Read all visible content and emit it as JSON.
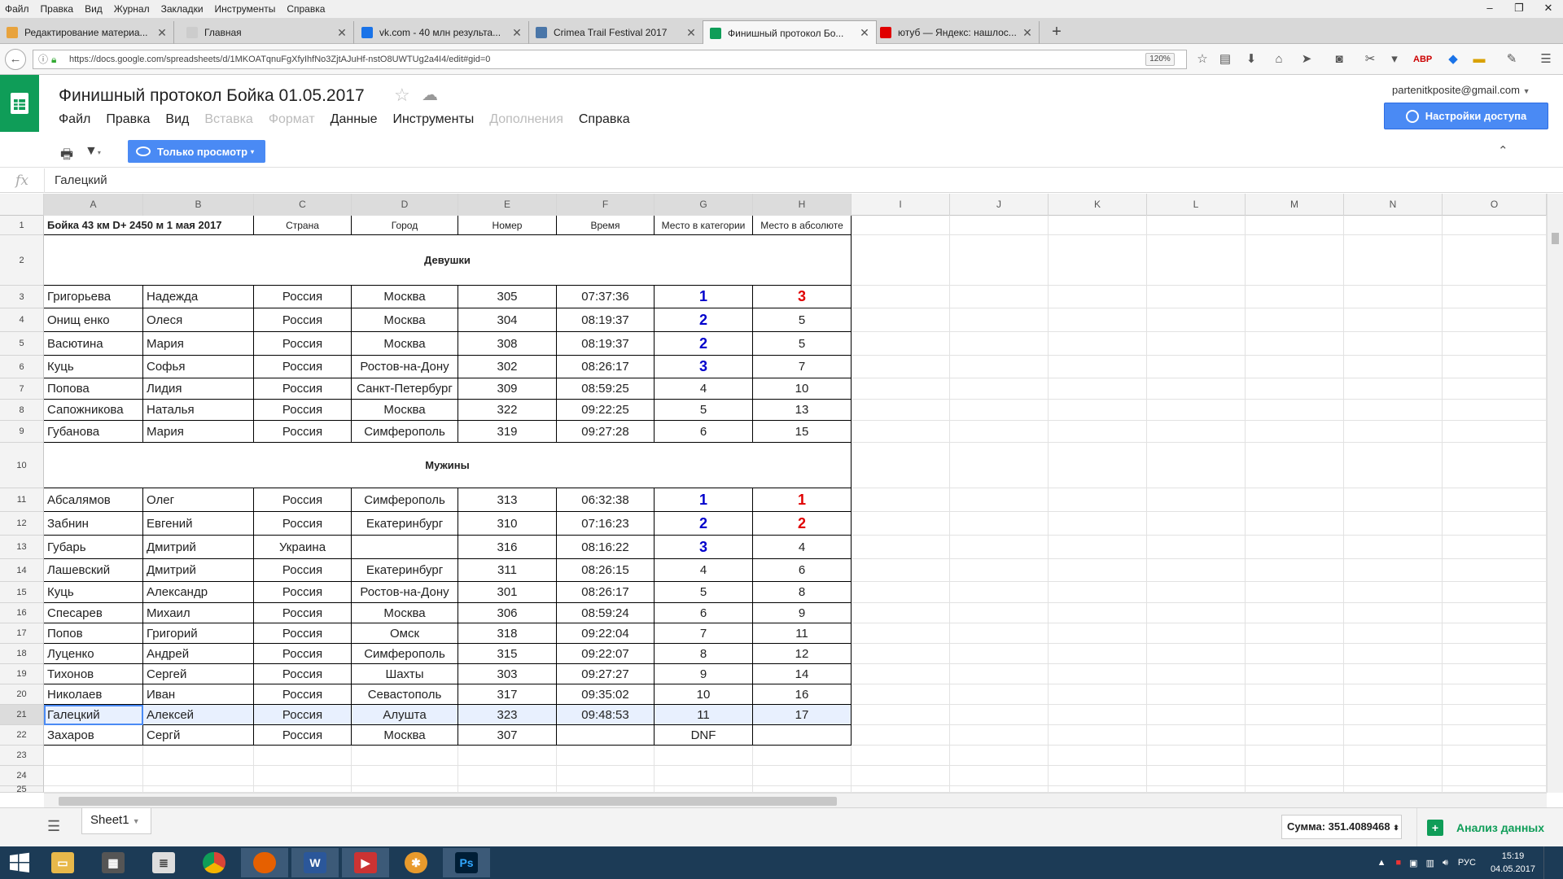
{
  "browser": {
    "menu": [
      "Файл",
      "Правка",
      "Вид",
      "Журнал",
      "Закладки",
      "Инструменты",
      "Справка"
    ],
    "tabs": [
      {
        "label": "Редактирование материа...",
        "color": "#e8a33d"
      },
      {
        "label": "Главная",
        "color": "#cccccc"
      },
      {
        "label": "vk.com - 40 млн результа...",
        "color": "#1a73e8"
      },
      {
        "label": "Crimea Trail Festival 2017",
        "color": "#4a76a8"
      },
      {
        "label": "Финишный протокол Бо...",
        "color": "#0f9d58"
      },
      {
        "label": "ютуб — Яндекс: нашлос...",
        "color": "#e00000"
      }
    ],
    "url": "https://docs.google.com/spreadsheets/d/1MKOATqnuFgXfyIhfNo3ZjtAJuHf-nstO8UWTUg2a4I4/edit#gid=0",
    "zoom": "120%"
  },
  "doc": {
    "title": "Финишный протокол Бойка 01.05.2017",
    "menu": [
      {
        "label": "Файл",
        "disabled": false
      },
      {
        "label": "Правка",
        "disabled": false
      },
      {
        "label": "Вид",
        "disabled": false
      },
      {
        "label": "Вставка",
        "disabled": true
      },
      {
        "label": "Формат",
        "disabled": true
      },
      {
        "label": "Данные",
        "disabled": false
      },
      {
        "label": "Инструменты",
        "disabled": false
      },
      {
        "label": "Дополнения",
        "disabled": true
      },
      {
        "label": "Справка",
        "disabled": false
      }
    ],
    "account": "partenitkposite@gmail.com",
    "share": "Настройки доступа",
    "view_only": "Только просмотр",
    "formula_value": "Галецкий"
  },
  "sheet": {
    "columns": [
      "A",
      "B",
      "C",
      "D",
      "E",
      "F",
      "G",
      "H",
      "I",
      "J",
      "K",
      "L",
      "M",
      "N",
      "O"
    ],
    "header_row": [
      "Бойка 43 км D+ 2450 м 1 мая 2017",
      "",
      "Страна",
      "Город",
      "Номер",
      "Время",
      "Место в категории",
      "Место в абсолюте"
    ],
    "section_women": "Девушки",
    "section_men": "Мужины",
    "women": [
      [
        "Григорьева",
        "Надежда",
        "Россия",
        "Москва",
        "305",
        "07:37:36",
        "1",
        "3"
      ],
      [
        "Онищ енко",
        "Олеся",
        "Россия",
        "Москва",
        "304",
        "08:19:37",
        "2",
        "5"
      ],
      [
        "Васютина",
        "Мария",
        "Россия",
        "Москва",
        "308",
        "08:19:37",
        "2",
        "5"
      ],
      [
        "Куць",
        "Софья",
        "Россия",
        "Ростов-на-Дону",
        "302",
        "08:26:17",
        "3",
        "7"
      ],
      [
        "Попова",
        "Лидия",
        "Россия",
        "Санкт-Петербург",
        "309",
        "08:59:25",
        "4",
        "10"
      ],
      [
        "Сапожникова",
        "Наталья",
        "Россия",
        "Москва",
        "322",
        "09:22:25",
        "5",
        "13"
      ],
      [
        "Губанова",
        "Мария",
        "Россия",
        "Симферополь",
        "319",
        "09:27:28",
        "6",
        "15"
      ]
    ],
    "men": [
      [
        "Абсалямов",
        "Олег",
        "Россия",
        "Симферополь",
        "313",
        "06:32:38",
        "1",
        "1"
      ],
      [
        "Забнин",
        "Евгений",
        "Россия",
        "Екатеринбург",
        "310",
        "07:16:23",
        "2",
        "2"
      ],
      [
        "Губарь",
        "Дмитрий",
        "Украина",
        "",
        "316",
        "08:16:22",
        "3",
        "4"
      ],
      [
        "Лашевский",
        "Дмитрий",
        "Россия",
        "Екатеринбург",
        "311",
        "08:26:15",
        "4",
        "6"
      ],
      [
        "Куць",
        "Александр",
        "Россия",
        "Ростов-на-Дону",
        "301",
        "08:26:17",
        "5",
        "8"
      ],
      [
        "Спесарев",
        "Михаил",
        "Россия",
        "Москва",
        "306",
        "08:59:24",
        "6",
        "9"
      ],
      [
        "Попов",
        "Григорий",
        "Россия",
        "Омск",
        "318",
        "09:22:04",
        "7",
        "11"
      ],
      [
        "Луценко",
        "Андрей",
        "Россия",
        "Симферополь",
        "315",
        "09:22:07",
        "8",
        "12"
      ],
      [
        "Тихонов",
        "Сергей",
        "Россия",
        "Шахты",
        "303",
        "09:27:27",
        "9",
        "14"
      ],
      [
        "Николаев",
        "Иван",
        "Россия",
        "Севастополь",
        "317",
        "09:35:02",
        "10",
        "16"
      ],
      [
        "Галецкий",
        "Алексей",
        "Россия",
        "Алушта",
        "323",
        "09:48:53",
        "11",
        "17"
      ],
      [
        "Захаров",
        "Сергй",
        "Россия",
        "Москва",
        "307",
        "",
        "DNF",
        ""
      ]
    ],
    "row_numbers": [
      "1",
      "2",
      "3",
      "4",
      "5",
      "6",
      "7",
      "8",
      "9",
      "10",
      "11",
      "12",
      "13",
      "14",
      "15",
      "16",
      "17",
      "18",
      "19",
      "20",
      "21",
      "22",
      "23",
      "24",
      "25"
    ],
    "tab_name": "Sheet1",
    "sum": "Сумма: 351.4089468",
    "explore": "Анализ данных"
  },
  "taskbar": {
    "lang": "РУС",
    "time": "15:19",
    "date": "04.05.2017"
  }
}
